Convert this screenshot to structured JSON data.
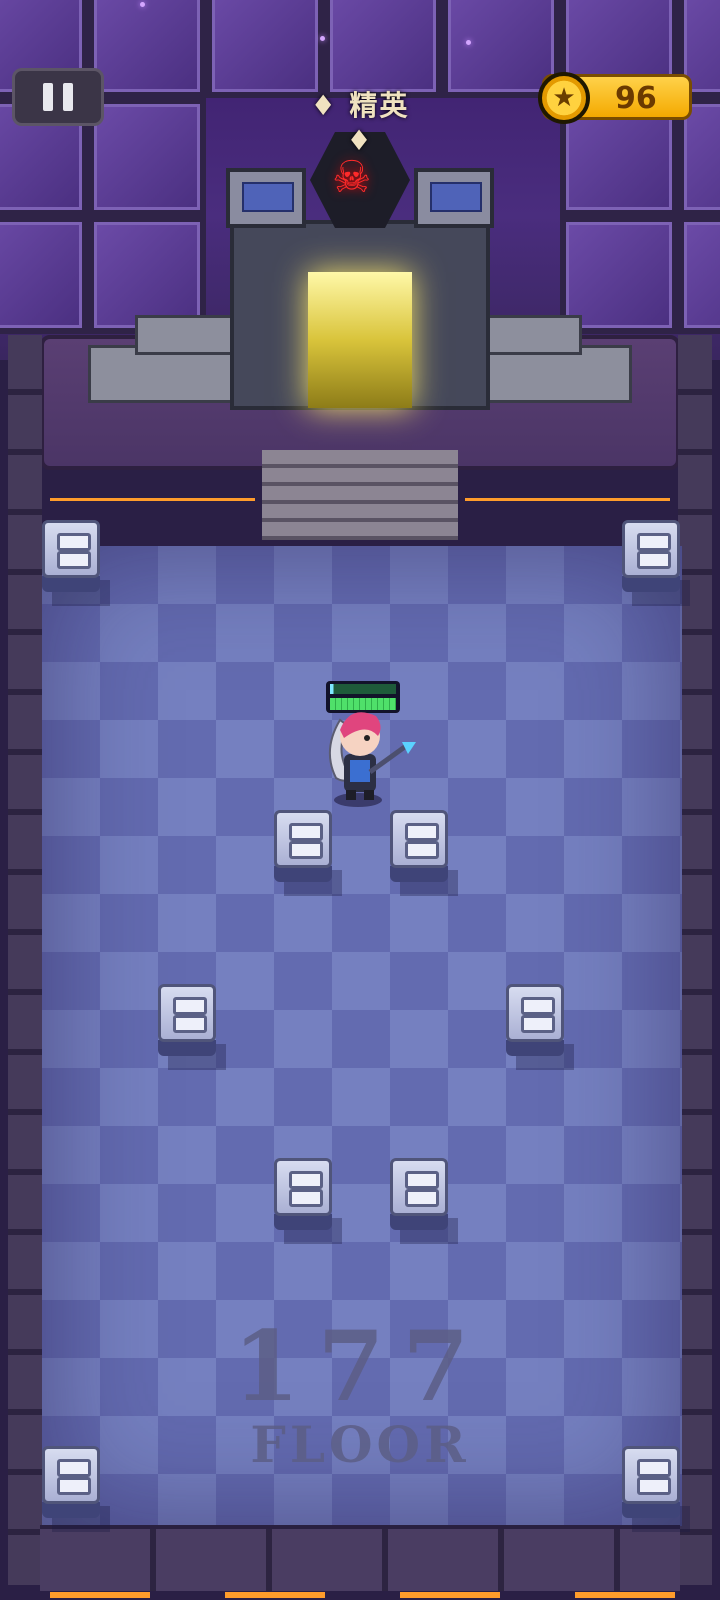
{
  "hud": {
    "pause_label": "",
    "coins": "96",
    "difficulty_label": "♦ 精英 ♦"
  },
  "room": {
    "floor_number": "177",
    "floor_word": "FLOOR"
  },
  "player": {
    "health_fraction": 1.0,
    "shield_fraction": 0.05
  },
  "icons": {
    "pause": "pause-icon",
    "coin": "star-coin-icon",
    "boss": "skull-icon"
  },
  "colors": {
    "coin_gold": "#f4a900",
    "boss_red": "#ff2a2a",
    "health_green": "#4fe06a"
  }
}
